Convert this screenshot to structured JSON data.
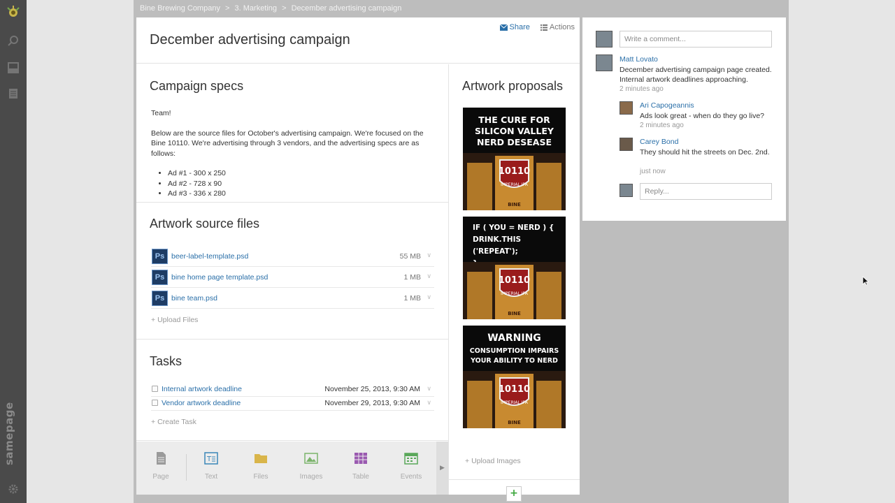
{
  "app": {
    "brand": "samepage"
  },
  "breadcrumb": {
    "items": [
      "Bine Brewing Company",
      "3. Marketing",
      "December advertising campaign"
    ],
    "separator": ">"
  },
  "page": {
    "title": "December advertising campaign",
    "share_label": "Share",
    "actions_label": "Actions"
  },
  "specs": {
    "heading": "Campaign specs",
    "greeting": "Team!",
    "paragraph": "Below are the source files for October's advertising campaign. We're focused on the Bine 10110.  We're advertising through 3 vendors, and the advertising specs are as follows:",
    "items": [
      "Ad #1 - 300 x 250",
      "Ad #2 - 728 x 90",
      "Ad #3 - 336 x 280"
    ]
  },
  "files": {
    "heading": "Artwork source files",
    "icon_label": "Ps",
    "rows": [
      {
        "name": "beer-label-template.psd",
        "size": "55 MB"
      },
      {
        "name": "bine home page template.psd",
        "size": "1 MB"
      },
      {
        "name": "bine team.psd",
        "size": "1 MB"
      }
    ],
    "upload_label": "Upload Files"
  },
  "tasks": {
    "heading": "Tasks",
    "rows": [
      {
        "name": "Internal artwork deadline",
        "date": "November 25, 2013, 9:30 AM"
      },
      {
        "name": "Vendor artwork deadline",
        "date": "November 29, 2013, 9:30 AM"
      }
    ],
    "create_label": "Create Task"
  },
  "toolbar": {
    "items": [
      {
        "label": "Page",
        "color": "#9a9a9a"
      },
      {
        "label": "Text",
        "color": "#3a86b8"
      },
      {
        "label": "Files",
        "color": "#d9b54a"
      },
      {
        "label": "Images",
        "color": "#7ab36a"
      },
      {
        "label": "Table",
        "color": "#9a5ab0"
      },
      {
        "label": "Events",
        "color": "#5aa85a"
      }
    ]
  },
  "artwork": {
    "heading": "Artwork proposals",
    "images": [
      {
        "caption_lines": [
          "THE CURE FOR",
          "SILICON VALLEY",
          "NERD DESEASE"
        ]
      },
      {
        "caption_lines": [
          "IF ( YOU = NERD ) {",
          "DRINK.THIS ('REPEAT');",
          "}"
        ]
      },
      {
        "caption_lines": [
          "WARNING",
          "CONSUMPTION IMPAIRS",
          "YOUR ABILITY TO NERD"
        ]
      }
    ],
    "can_label": "10110",
    "can_sub": "IMPERIAL IPA",
    "can_brand": "BINE",
    "upload_label": "Upload Images",
    "add_label": "+"
  },
  "comments": {
    "placeholder": "Write a comment...",
    "main": {
      "author": "Matt Lovato",
      "text_lines": [
        "December advertising campaign page created.",
        "Internal artwork deadlines approaching."
      ],
      "time": "2 minutes ago"
    },
    "replies": [
      {
        "author": "Ari Capogeannis",
        "text": "Ads look great - when do they go live?",
        "time": "2 minutes ago"
      },
      {
        "author": "Carey Bond",
        "text": "They should hit the streets on Dec. 2nd.",
        "time": "just now"
      }
    ],
    "reply_placeholder": "Reply..."
  }
}
